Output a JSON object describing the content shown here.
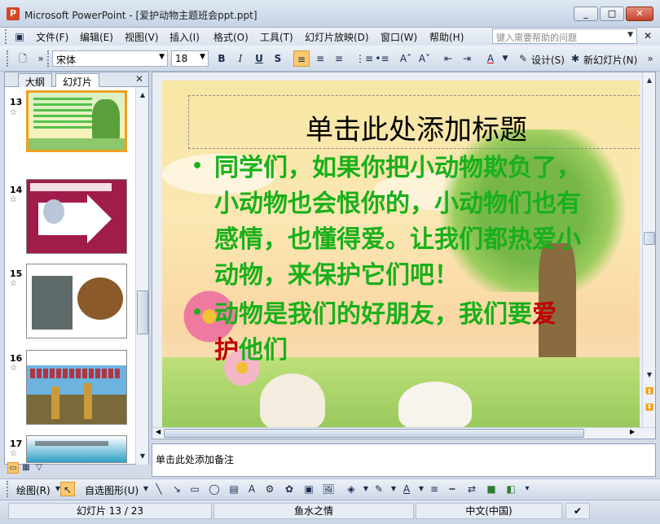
{
  "window": {
    "title": "Microsoft PowerPoint - [爱护动物主题班会ppt.ppt]",
    "min_icon": "minimize-icon",
    "max_icon": "maximize-icon",
    "close_icon": "close-icon"
  },
  "menu": {
    "items": [
      "文件(F)",
      "编辑(E)",
      "视图(V)",
      "插入(I)",
      "格式(O)",
      "工具(T)",
      "幻灯片放映(D)",
      "窗口(W)",
      "帮助(H)"
    ],
    "help_placeholder": "键入需要帮助的问题"
  },
  "toolbar": {
    "font_name": "宋体",
    "font_size": "18",
    "bold": "B",
    "italic": "I",
    "underline": "U",
    "shadow": "S",
    "design_label": "设计(S)",
    "new_slide_label": "新幻灯片(N)"
  },
  "left_pane": {
    "tabs": [
      "大纲",
      "幻灯片"
    ],
    "thumbnails": [
      {
        "num": "13",
        "selected": true
      },
      {
        "num": "14",
        "selected": false
      },
      {
        "num": "15",
        "selected": false
      },
      {
        "num": "16",
        "selected": false
      },
      {
        "num": "17",
        "selected": false
      }
    ]
  },
  "slide": {
    "title": "单击此处添加标题",
    "bullet1_lines": [
      "同学们，如果你把小动物欺负了，",
      "小动物也会恨你的，小动物们也有",
      "感情，也懂得爱。让我们都热爱小",
      "动物，来保护它们吧！"
    ],
    "bullet2_a": "动物是我们的好朋友，我们要",
    "bullet2_red1": "爱",
    "bullet2_red2": "护",
    "bullet2_b": "他们"
  },
  "notes": {
    "placeholder": "单击此处添加备注"
  },
  "drawbar": {
    "draw_label": "绘图(R)",
    "autoshape_label": "自选图形(U)"
  },
  "status": {
    "slide_info": "幻灯片 13 / 23",
    "design": "鱼水之情",
    "language": "中文(中国)"
  }
}
